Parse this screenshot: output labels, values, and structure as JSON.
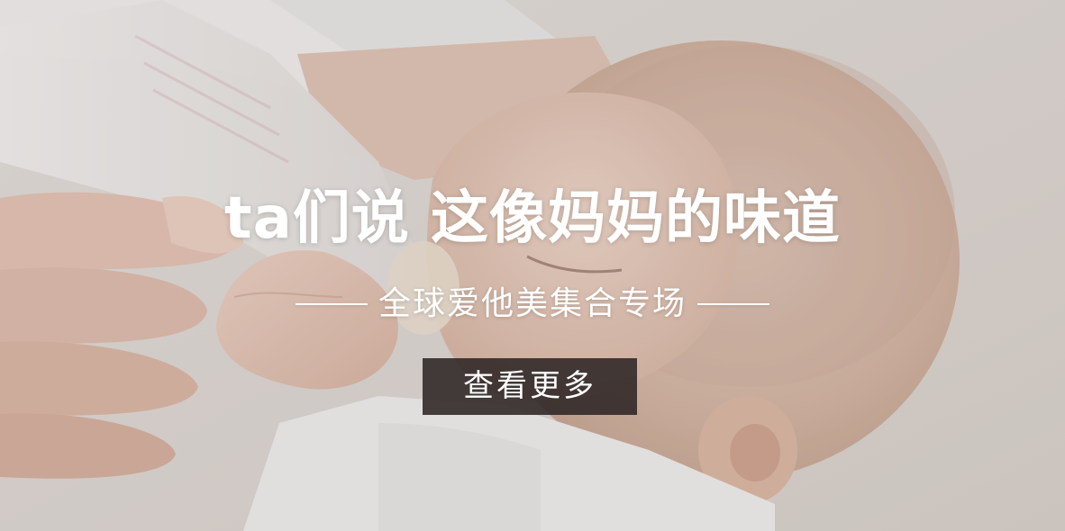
{
  "banner": {
    "headline": "ta们说 这像妈妈的味道",
    "subtitle": "全球爱他美集合专场",
    "cta_label": "查看更多"
  },
  "theme": {
    "text_color": "#ffffff",
    "button_bg": "#2d2624",
    "background": "#d8d3cd"
  }
}
